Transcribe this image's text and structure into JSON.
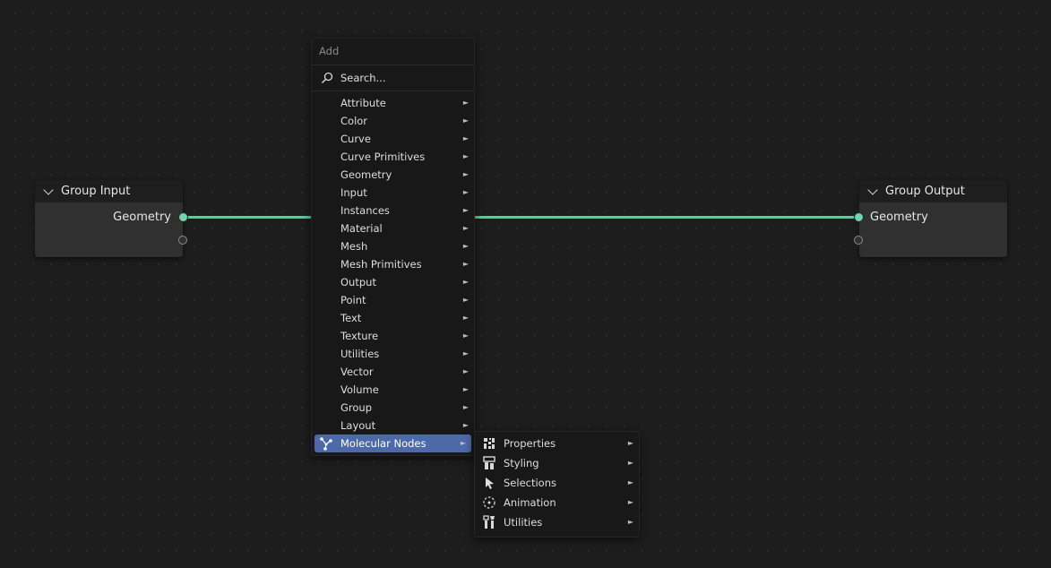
{
  "nodes": {
    "group_input": {
      "title": "Group Input",
      "socket_label": "Geometry"
    },
    "group_output": {
      "title": "Group Output",
      "socket_label": "Geometry"
    }
  },
  "add_menu": {
    "title": "Add",
    "search_placeholder": "Search...",
    "items": [
      {
        "label": "Attribute"
      },
      {
        "label": "Color"
      },
      {
        "label": "Curve"
      },
      {
        "label": "Curve Primitives"
      },
      {
        "label": "Geometry"
      },
      {
        "label": "Input"
      },
      {
        "label": "Instances"
      },
      {
        "label": "Material"
      },
      {
        "label": "Mesh"
      },
      {
        "label": "Mesh Primitives"
      },
      {
        "label": "Output"
      },
      {
        "label": "Point"
      },
      {
        "label": "Text"
      },
      {
        "label": "Texture"
      },
      {
        "label": "Utilities"
      },
      {
        "label": "Vector"
      },
      {
        "label": "Volume"
      },
      {
        "label": "Group"
      },
      {
        "label": "Layout"
      },
      {
        "label": "Molecular Nodes"
      }
    ],
    "active_item": "Molecular Nodes"
  },
  "submenu": {
    "items": [
      {
        "label": "Properties",
        "icon": "properties-icon"
      },
      {
        "label": "Styling",
        "icon": "styling-icon"
      },
      {
        "label": "Selections",
        "icon": "selection-cursor-icon"
      },
      {
        "label": "Animation",
        "icon": "animation-icon"
      },
      {
        "label": "Utilities",
        "icon": "utilities-icon"
      }
    ]
  },
  "colors": {
    "link": "#5fc7a1",
    "geometry_socket": "#6fd6b0",
    "menu_highlight": "#4d6aa8",
    "background": "#1d1d1d"
  },
  "arrow_glyph": "►"
}
